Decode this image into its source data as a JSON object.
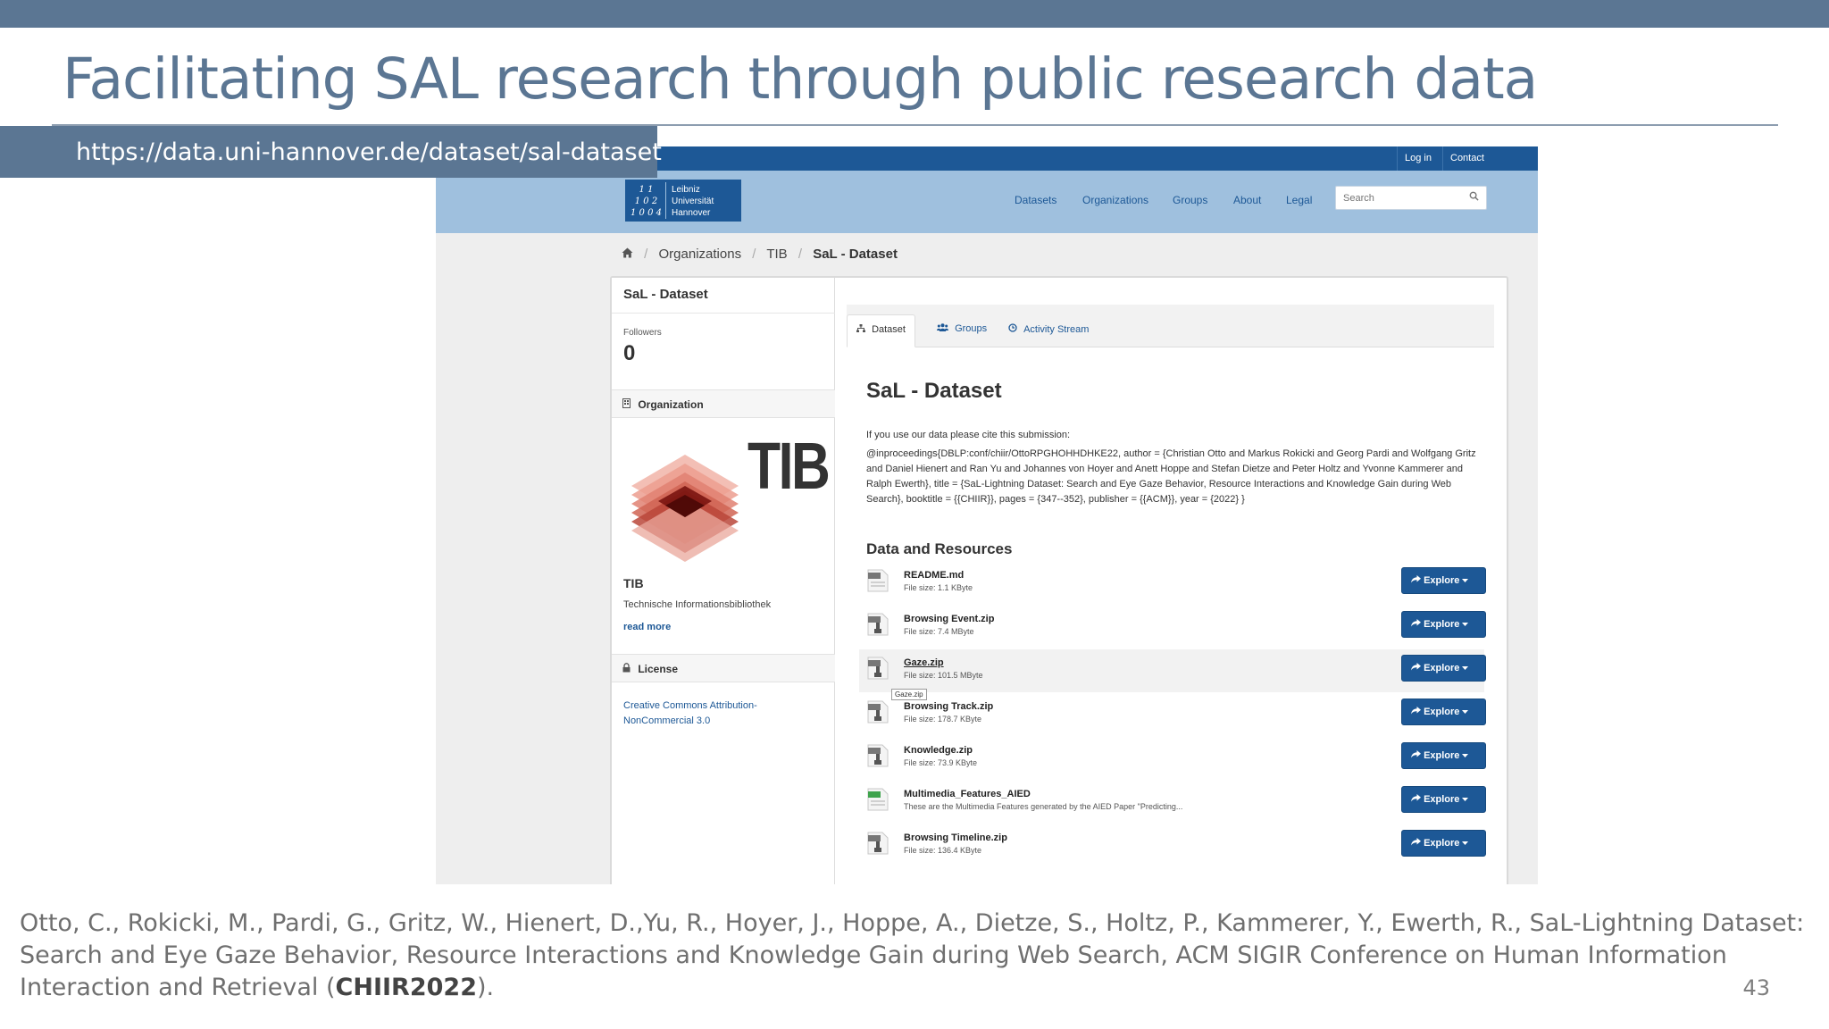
{
  "slide": {
    "title": "Facilitating SAL research through public research data",
    "url": "https://data.uni-hannover.de/dataset/sal-dataset",
    "citation_text": "Otto, C., Rokicki, M., Pardi, G., Gritz, W., Hienert, D.,Yu, R., Hoyer, J., Hoppe, A., Dietze, S., Holtz, P., Kammerer, Y., Ewerth, R., SaL-Lightning Dataset: Search and Eye Gaze Behavior, Resource Interactions and Knowledge Gain during Web Search, ACM SIGIR Conference on Human Information Interaction and Retrieval (",
    "citation_bold": "CHIIR2022",
    "citation_end": ").",
    "page_number": "43"
  },
  "colors": {
    "slide_accent": "#5b7693",
    "portal_blue": "#1d5896",
    "masthead": "#9fc0de"
  },
  "portal": {
    "topbar": {
      "login": "Log in",
      "contact": "Contact"
    },
    "logo": {
      "mark_lines": [
        "1 1",
        "1 0 2",
        "1 0 0 4"
      ],
      "text_lines": [
        "Leibniz",
        "Universität",
        "Hannover"
      ]
    },
    "nav": [
      "Datasets",
      "Organizations",
      "Groups",
      "About",
      "Legal"
    ],
    "search": {
      "placeholder": "Search",
      "icon": "search-icon"
    },
    "breadcrumb": {
      "home_icon": "home-icon",
      "items": [
        "Organizations",
        "TIB",
        "SaL - Dataset"
      ]
    },
    "sidebar": {
      "title": "SaL - Dataset",
      "followers_label": "Followers",
      "followers_count": "0",
      "organization_heading": "Organization",
      "org_logo_text": "TIB",
      "org_name": "TIB",
      "org_description": "Technische Informationsbibliothek",
      "read_more": "read more",
      "license_heading": "License",
      "license_text": "Creative Commons Attribution-NonCommercial 3.0"
    },
    "tabs": [
      {
        "label": "Dataset",
        "icon": "sitemap-icon",
        "active": true
      },
      {
        "label": "Groups",
        "icon": "users-icon",
        "active": false
      },
      {
        "label": "Activity Stream",
        "icon": "clock-icon",
        "active": false
      }
    ],
    "dataset": {
      "title": "SaL - Dataset",
      "cite_note": "If you use our data please cite this submission:",
      "bibtex": "@inproceedings{DBLP:conf/chiir/OttoRPGHOHHDHKE22, author = {Christian Otto and Markus Rokicki and Georg Pardi and Wolfgang Gritz and Daniel Hienert and Ran Yu and Johannes von Hoyer and Anett Hoppe and Stefan Dietze and Peter Holtz and Yvonne Kammerer and Ralph Ewerth}, title = {SaL-Lightning Dataset: Search and Eye Gaze Behavior, Resource Interactions and Knowledge Gain during Web Search}, booktitle = {{CHIIR}}, pages = {347--352}, publisher = {{ACM}}, year = {2022} }",
      "resources_heading": "Data and Resources",
      "explore_label": "Explore",
      "resources": [
        {
          "name": "README.md",
          "detail": "File size: 1.1 KByte",
          "format": "DATA",
          "hover": false
        },
        {
          "name": "Browsing Event.zip",
          "detail": "File size: 7.4 MByte",
          "format": "ZIP",
          "hover": false
        },
        {
          "name": "Gaze.zip",
          "detail": "File size: 101.5 MByte",
          "format": "ZIP",
          "hover": true,
          "tooltip": "Gaze.zip"
        },
        {
          "name": "Browsing Track.zip",
          "detail": "File size: 178.7 KByte",
          "format": "ZIP",
          "hover": false
        },
        {
          "name": "Knowledge.zip",
          "detail": "File size: 73.9 KByte",
          "format": "ZIP",
          "hover": false
        },
        {
          "name": "Multimedia_Features_AIED",
          "detail": "These are the Multimedia Features generated by the AIED Paper \"Predicting...",
          "format": "CSV",
          "hover": false
        },
        {
          "name": "Browsing Timeline.zip",
          "detail": "File size: 136.4 KByte",
          "format": "ZIP",
          "hover": false
        }
      ]
    }
  }
}
